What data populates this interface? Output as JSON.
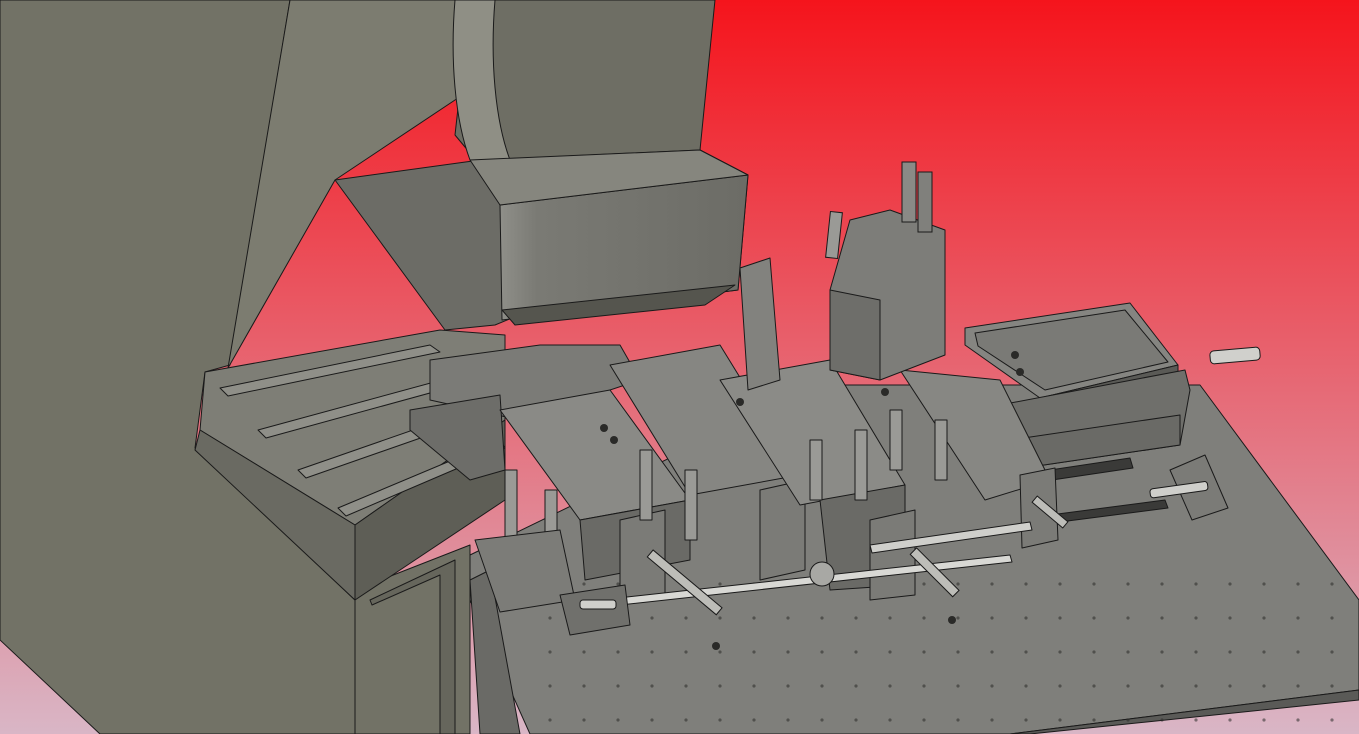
{
  "viewport": {
    "background_gradient": {
      "top": "#f5141c",
      "bottom": "#d9b6c6"
    },
    "model_colors": {
      "machine_body": "#727266",
      "machine_body_dark": "#5f5f56",
      "metal_light": "#8a8a86",
      "metal_mid": "#7b7b77",
      "metal_dark": "#4d4d4a",
      "edge_line": "#1a1a1a",
      "hardware": "#2a2a28",
      "highlight": "#d8d8d4"
    },
    "model_parts": [
      "press-frame",
      "press-ram-head",
      "press-bed",
      "base-table",
      "linear-rail-modules",
      "pneumatic-cylinders",
      "feed-tray",
      "loose-pins"
    ]
  }
}
